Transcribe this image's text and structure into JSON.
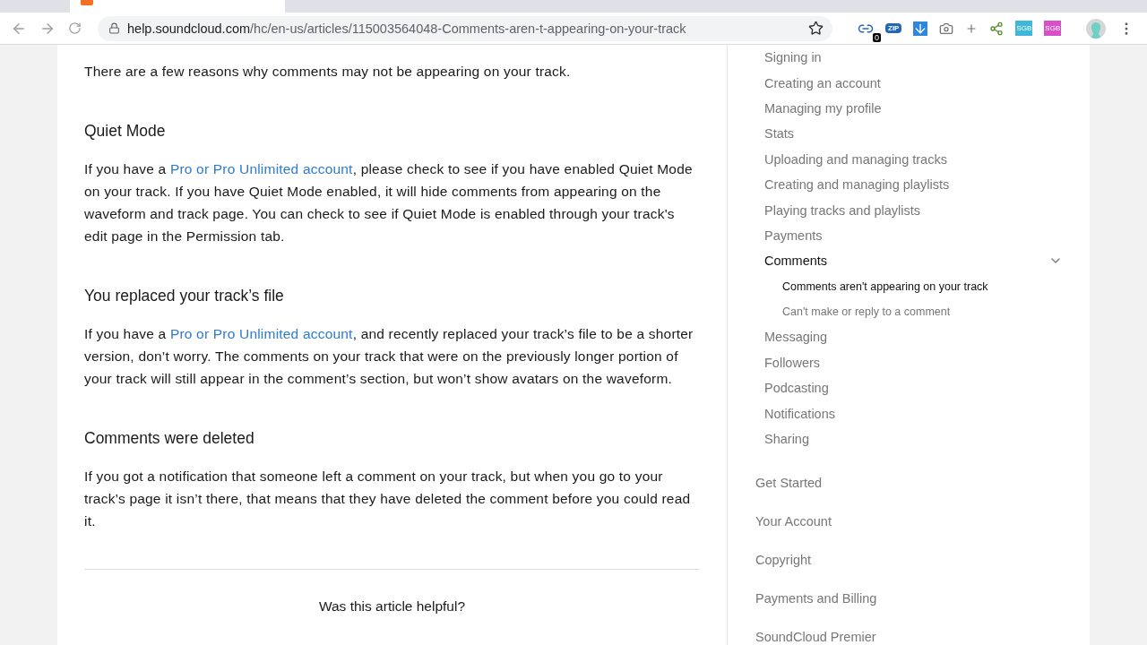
{
  "browser": {
    "url_host": "help.soundcloud.com",
    "url_path": "/hc/en-us/articles/115003564048-Comments-aren-t-appearing-on-your-track",
    "bookmarked": false,
    "extension_badge": "0",
    "extensions": [
      {
        "kind": "link"
      },
      {
        "kind": "zip",
        "label": "ZIP"
      },
      {
        "kind": "download"
      },
      {
        "kind": "camera"
      },
      {
        "kind": "plus"
      },
      {
        "kind": "share"
      },
      {
        "kind": "sgb",
        "label": "SGB",
        "color": "#3fb8d8"
      },
      {
        "kind": "sgb",
        "label": "SGB",
        "color": "#d94fc8"
      }
    ]
  },
  "article": {
    "intro": "There are a few reasons why comments may not be appearing on your track.",
    "sections": [
      {
        "heading": "Quiet Mode",
        "link": "Pro or Pro Unlimited account",
        "before": "If you have a ",
        "after": ", please check to see if you have enabled Quiet Mode on your track. If you have Quiet Mode enabled, it will hide comments from appearing on the waveform and track page. You can check to see if Quiet Mode is enabled through your track's edit page in the Permission tab."
      },
      {
        "heading": "You replaced your track’s file",
        "link": "Pro or Pro Unlimited account",
        "before": "If you have a ",
        "after": ", and recently replaced your track’s file to be a shorter version, don’t worry. The comments on your track that were on the previously longer portion of your track will still appear in the comment’s section, but won’t show avatars on the waveform."
      },
      {
        "heading": "Comments were deleted",
        "before": "If you got a notification that someone left a comment on your track, but when you go to your track’s page it isn’t there, that means that they have deleted the comment before you could read it."
      }
    ],
    "feedback_question": "Was this article helpful?"
  },
  "sidebar": {
    "subsections": [
      {
        "label": "Signing in",
        "selected": false
      },
      {
        "label": "Creating an account",
        "selected": false
      },
      {
        "label": "Managing my profile",
        "selected": false
      },
      {
        "label": "Stats",
        "selected": false
      },
      {
        "label": "Uploading and managing tracks",
        "selected": false
      },
      {
        "label": "Creating and managing playlists",
        "selected": false
      },
      {
        "label": "Playing tracks and playlists",
        "selected": false
      },
      {
        "label": "Payments",
        "selected": false
      },
      {
        "label": "Comments",
        "selected": true,
        "expanded": true,
        "children": [
          {
            "label": "Comments aren't appearing on your track",
            "selected": true
          },
          {
            "label": "Can't make or reply to a comment",
            "selected": false
          }
        ]
      },
      {
        "label": "Messaging",
        "selected": false
      },
      {
        "label": "Followers",
        "selected": false
      },
      {
        "label": "Podcasting",
        "selected": false
      },
      {
        "label": "Notifications",
        "selected": false
      },
      {
        "label": "Sharing",
        "selected": false
      }
    ],
    "categories": [
      "Get Started",
      "Your Account",
      "Copyright",
      "Payments and Billing",
      "SoundCloud Premier"
    ]
  }
}
